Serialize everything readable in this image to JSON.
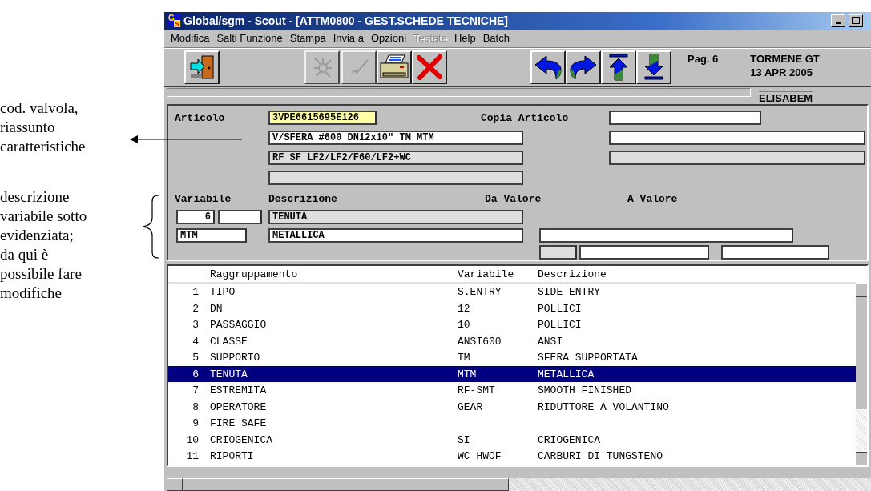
{
  "annotations": [
    {
      "text": "cod. valvola,\nriassunto\ncaratteristiche",
      "kind": "arrow"
    },
    {
      "text": "descrizione\nvariabile sotto\nevidenziata;\nda qui è\npossibile fare\nmodifiche",
      "kind": "brace"
    }
  ],
  "window": {
    "logo": [
      "G",
      "s"
    ],
    "title": "Global/sgm - Scout - [ATTM0800 - GEST.SCHEDE TECNICHE]",
    "menu": [
      {
        "label": "Modifica",
        "disabled": false
      },
      {
        "label": "Salti Funzione",
        "disabled": false
      },
      {
        "label": "Stampa",
        "disabled": false
      },
      {
        "label": "Invia a",
        "disabled": false
      },
      {
        "label": "Opzioni",
        "disabled": false
      },
      {
        "label": "Testata",
        "disabled": true
      },
      {
        "label": "Help",
        "disabled": false
      },
      {
        "label": "Batch",
        "disabled": false
      }
    ],
    "toolbar": [
      {
        "kind": "exit",
        "disabled": false
      },
      {
        "kind": "tool",
        "disabled": true
      },
      {
        "kind": "check",
        "disabled": true
      },
      {
        "kind": "print",
        "disabled": false
      },
      {
        "kind": "cancel",
        "disabled": false
      },
      {
        "kind": "back",
        "disabled": false
      },
      {
        "kind": "forward",
        "disabled": false
      },
      {
        "kind": "first",
        "disabled": false
      },
      {
        "kind": "last",
        "disabled": false
      }
    ],
    "page": "Pag. 6",
    "company": "TORMENE GT",
    "date": "13 APR 2005",
    "user": "ELISABEM"
  },
  "form": {
    "articolo_label": "Articolo",
    "articolo": {
      "value": "3VPE6615695E126",
      "highlighted": true
    },
    "copia_label": "Copia Articolo",
    "copia": {
      "readonly": false
    },
    "rows": [
      {
        "left": {
          "value": "V/SFERA #600 DN12x10\" TM MTM",
          "readonly": false
        },
        "right": {
          "readonly": false
        }
      },
      {
        "left": {
          "value": "RF SF LF2/LF2/F60/LF2+WC",
          "readonly": true
        },
        "right": {
          "readonly": true
        }
      }
    ],
    "extra": {
      "readonly": true
    },
    "headers": {
      "variabile": "Variabile",
      "descrizione": "Descrizione",
      "da_valore": "Da Valore",
      "a_valore": "A Valore"
    },
    "number": {
      "value": "6",
      "readonly": false
    },
    "sub": {
      "readonly": false
    },
    "group_desc": {
      "value": "TENUTA",
      "readonly": true
    },
    "code": {
      "value": "MTM",
      "readonly": false
    },
    "code_desc": {
      "value": "METALLICA",
      "readonly": false
    },
    "da_valore": {
      "readonly": false
    },
    "bottom": [
      {
        "readonly": true
      },
      {
        "readonly": false
      },
      {
        "readonly": false
      }
    ]
  },
  "list": {
    "columns": [
      "Raggruppamento",
      "Variabile",
      "Descrizione"
    ],
    "rows": [
      {
        "number": "1",
        "group": "TIPO",
        "variable": "S.ENTRY",
        "description": "SIDE ENTRY",
        "selected": false
      },
      {
        "number": "2",
        "group": "DN",
        "variable": "12",
        "description": "POLLICI",
        "selected": false
      },
      {
        "number": "3",
        "group": "PASSAGGIO",
        "variable": "10",
        "description": "POLLICI",
        "selected": false
      },
      {
        "number": "4",
        "group": "CLASSE",
        "variable": "ANSI600",
        "description": "ANSI",
        "selected": false
      },
      {
        "number": "5",
        "group": "SUPPORTO",
        "variable": "TM",
        "description": "SFERA SUPPORTATA",
        "selected": false
      },
      {
        "number": "6",
        "group": "TENUTA",
        "variable": "MTM",
        "description": "METALLICA",
        "selected": true
      },
      {
        "number": "7",
        "group": "ESTREMITA",
        "variable": "RF-SMT",
        "description": "SMOOTH FINISHED",
        "selected": false
      },
      {
        "number": "8",
        "group": "OPERATORE",
        "variable": "GEAR",
        "description": "RIDUTTORE A VOLANTINO",
        "selected": false
      },
      {
        "number": "9",
        "group": "FIRE SAFE",
        "selected": false
      },
      {
        "number": "10",
        "group": "CRIOGENICA",
        "variable": "SI",
        "description": "CRIOGENICA",
        "selected": false
      },
      {
        "number": "11",
        "group": "RIPORTI",
        "variable": "WC HWOF",
        "description": "CARBURI DI TUNGSTENO",
        "selected": false
      }
    ]
  }
}
